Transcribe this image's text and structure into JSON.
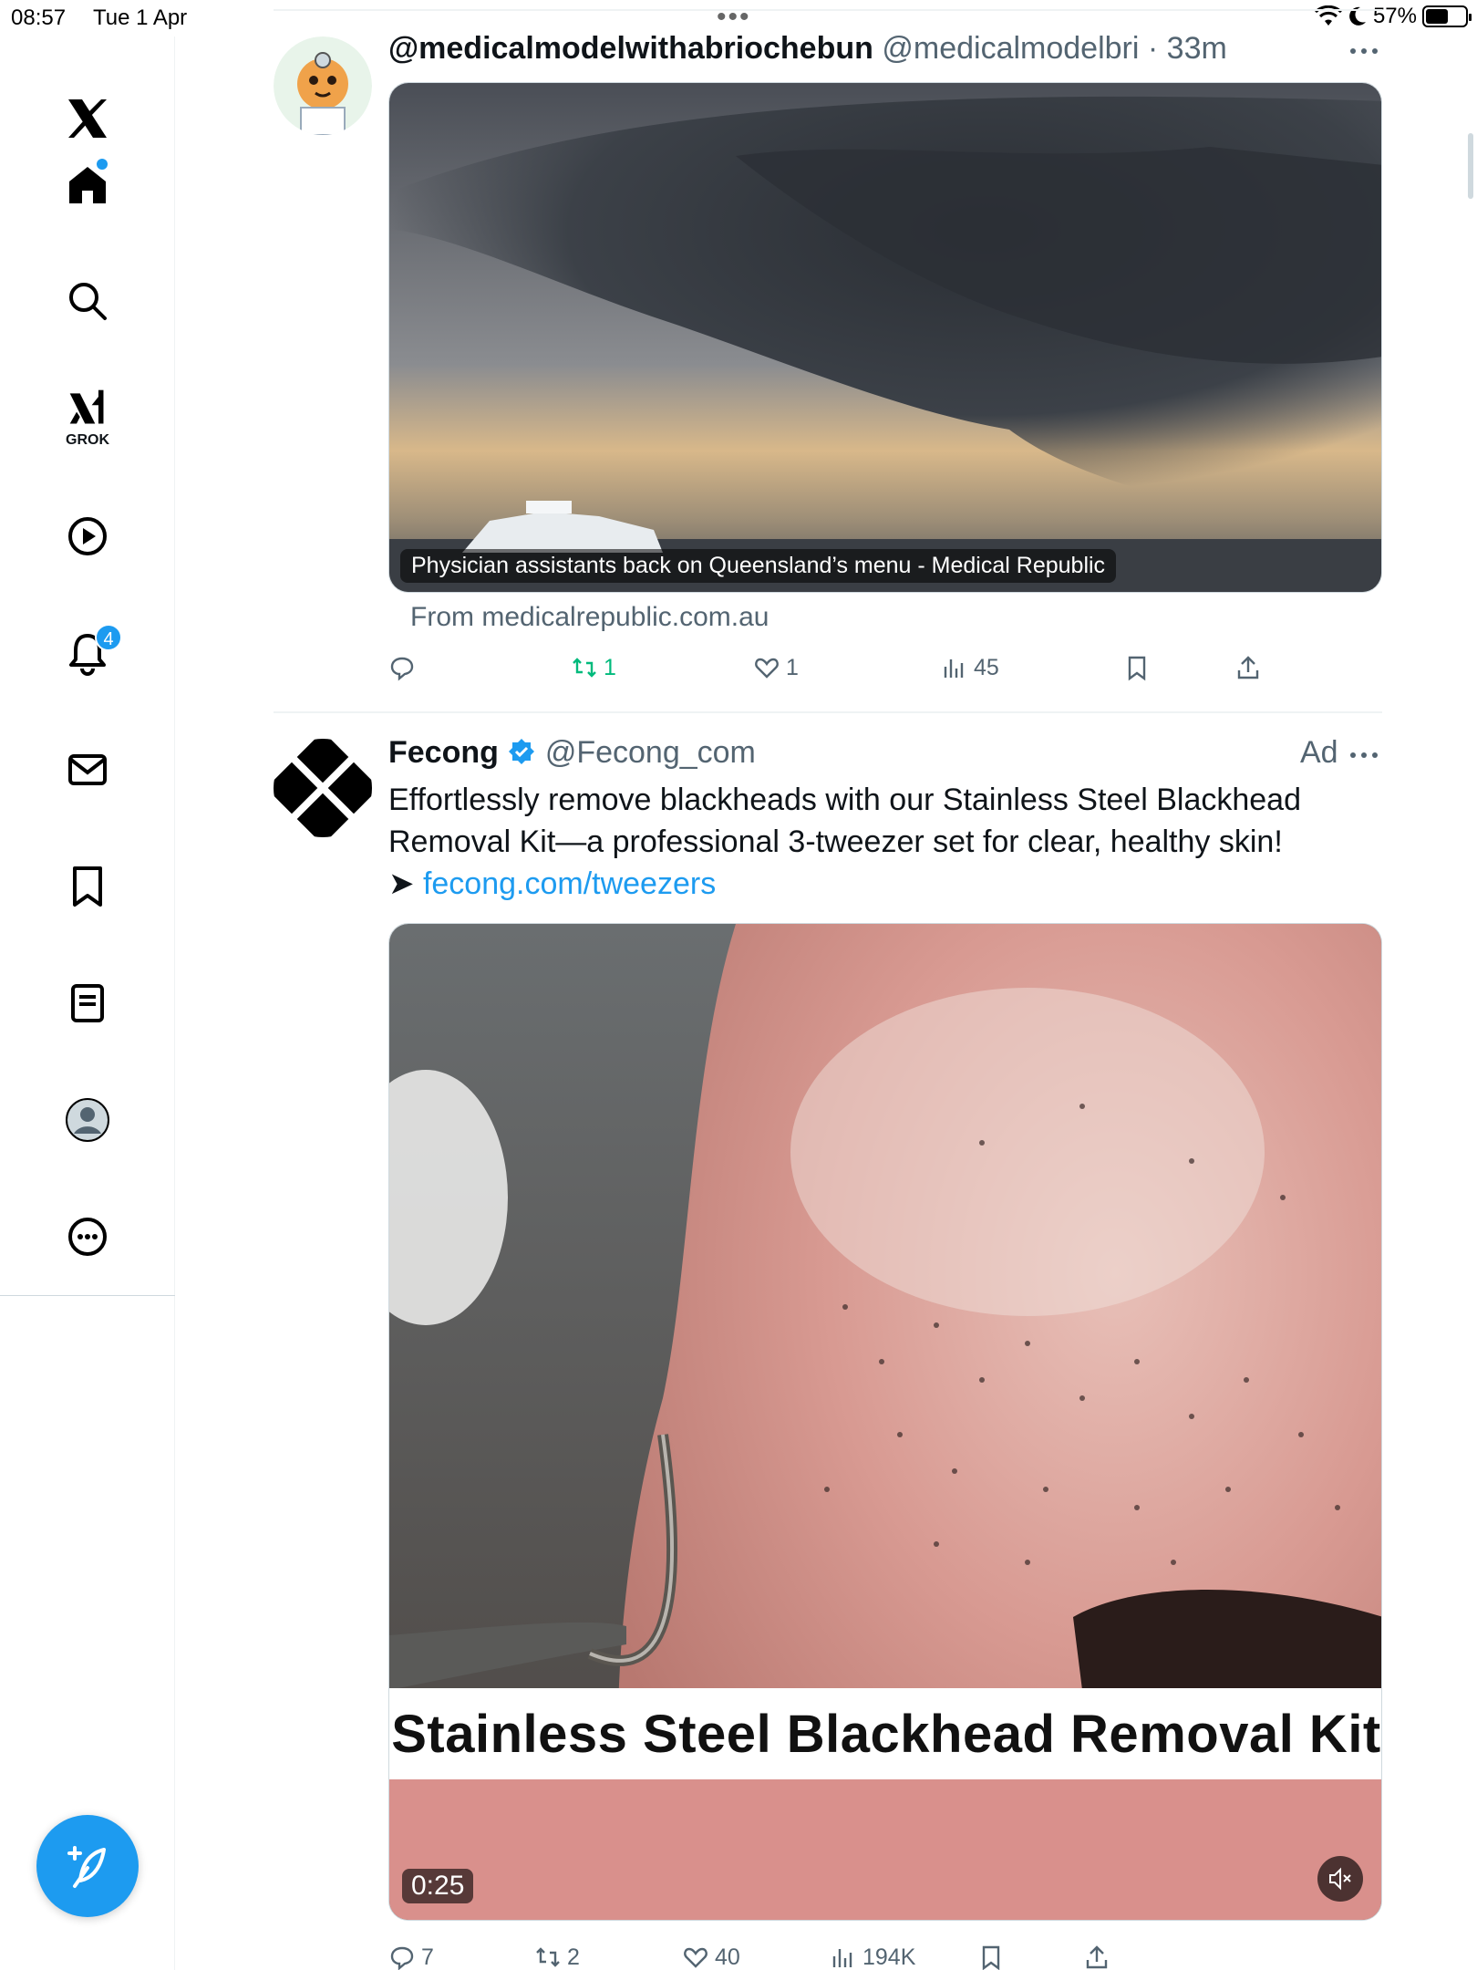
{
  "status_bar": {
    "time": "08:57",
    "date": "Tue 1 Apr",
    "battery_percent": "57%",
    "battery_level": 0.57
  },
  "sidebar": {
    "items": [
      {
        "name": "x-logo",
        "icon": "x-logo-icon"
      },
      {
        "name": "home",
        "icon": "home-icon",
        "has_dot": true
      },
      {
        "name": "explore",
        "icon": "search-icon"
      },
      {
        "name": "grok",
        "icon": "grok-icon",
        "label": "GROK"
      },
      {
        "name": "video",
        "icon": "play-icon"
      },
      {
        "name": "notifications",
        "icon": "bell-icon",
        "badge": "4"
      },
      {
        "name": "messages",
        "icon": "mail-icon"
      },
      {
        "name": "bookmarks",
        "icon": "bookmark-icon"
      },
      {
        "name": "lists",
        "icon": "list-icon"
      },
      {
        "name": "profile",
        "icon": "profile-avatar-icon"
      },
      {
        "name": "more",
        "icon": "more-circle-icon"
      }
    ],
    "compose_icon": "compose-icon"
  },
  "tweets": [
    {
      "display_name": "@medicalmodelwithabriochebun",
      "handle": "@medicalmodelbri",
      "separator": "·",
      "time": "33m",
      "card_caption": "Physician assistants back on Queensland’s menu - Medical Republic",
      "card_source": "From medicalrepublic.com.au",
      "actions": {
        "replies": "",
        "retweets": "1",
        "likes": "1",
        "views": "45"
      }
    },
    {
      "display_name": "Fecong",
      "verified": true,
      "handle": "@Fecong_com",
      "ad_label": "Ad",
      "text_line1": "Effortlessly remove blackheads with our Stainless Steel Blackhead",
      "text_line2": "Removal Kit—a professional 3-tweezer set for clear, healthy skin!",
      "text_arrow": "➤ ",
      "text_link": "fecong.com/tweezers",
      "video_banner": "Stainless Steel Blackhead Removal Kit",
      "video_duration": "0:25",
      "actions": {
        "replies": "7",
        "retweets": "2",
        "likes": "40",
        "views": "194K"
      }
    }
  ],
  "colors": {
    "accent": "#1d9bf0",
    "secondary_text": "#536471",
    "retweet_green": "#00ba7c"
  }
}
